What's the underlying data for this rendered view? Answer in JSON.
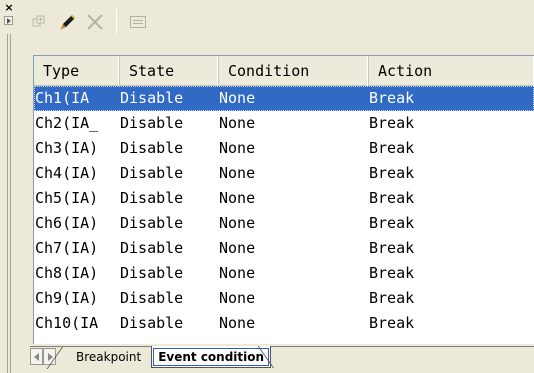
{
  "window": {
    "close_glyph": "×"
  },
  "toolbar": {
    "buttons": [
      {
        "name": "add-breakpoint-icon",
        "enabled": false
      },
      {
        "name": "edit-pencil-icon",
        "enabled": true
      },
      {
        "name": "delete-x-icon",
        "enabled": false
      },
      {
        "name": "properties-list-icon",
        "enabled": false
      }
    ]
  },
  "list": {
    "columns": [
      "Type",
      "State",
      "Condition",
      "Action"
    ],
    "rows": [
      {
        "type": "Ch1(IA",
        "state": "Disable",
        "condition": "None",
        "action": "Break",
        "selected": true
      },
      {
        "type": "Ch2(IA_",
        "state": "Disable",
        "condition": "None",
        "action": "Break",
        "selected": false
      },
      {
        "type": "Ch3(IA)",
        "state": "Disable",
        "condition": "None",
        "action": "Break",
        "selected": false
      },
      {
        "type": "Ch4(IA)",
        "state": "Disable",
        "condition": "None",
        "action": "Break",
        "selected": false
      },
      {
        "type": "Ch5(IA)",
        "state": "Disable",
        "condition": "None",
        "action": "Break",
        "selected": false
      },
      {
        "type": "Ch6(IA)",
        "state": "Disable",
        "condition": "None",
        "action": "Break",
        "selected": false
      },
      {
        "type": "Ch7(IA)",
        "state": "Disable",
        "condition": "None",
        "action": "Break",
        "selected": false
      },
      {
        "type": "Ch8(IA)",
        "state": "Disable",
        "condition": "None",
        "action": "Break",
        "selected": false
      },
      {
        "type": "Ch9(IA)",
        "state": "Disable",
        "condition": "None",
        "action": "Break",
        "selected": false
      },
      {
        "type": "Ch10(IA",
        "state": "Disable",
        "condition": "None",
        "action": "Break",
        "selected": false
      }
    ]
  },
  "tabs": {
    "items": [
      {
        "label": "Breakpoint",
        "active": false
      },
      {
        "label": "Event condition",
        "active": true
      }
    ]
  },
  "colors": {
    "selection": "#316ac5",
    "background": "#ece9d8"
  }
}
